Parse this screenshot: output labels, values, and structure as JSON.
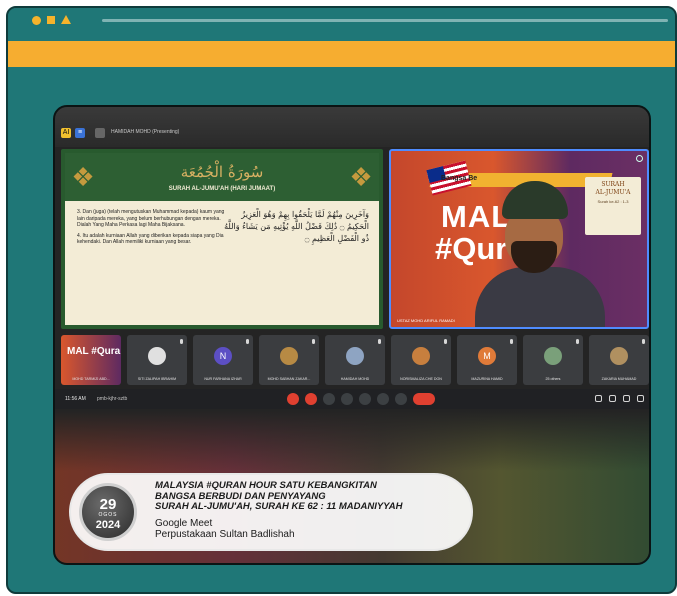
{
  "window": {
    "controls": [
      "circle",
      "square",
      "triangle"
    ],
    "accent": "#f6ad30",
    "frame_color": "#1f7777"
  },
  "meet": {
    "presenting_label": "HAMIDAH MOHD (Presenting)",
    "time": "11:56 AM",
    "code": "pmb-kjhr-sztb"
  },
  "slide": {
    "surah_arabic": "سُورَةُ الْجُمُعَة",
    "surah_title": "SURAH AL-JUMU'AH (HARI JUMAAT)",
    "verse3": "3. Dan (juga) (telah mengutuskan Muhammad kepada) kaum yang lain daripada mereka, yang belum berhubungan dengan mereka. Dialah Yang Maha Perkasa lagi Maha Bijaksana.",
    "verse4": "4. Itu adalah kurniaan Allah yang diberikan kepada siapa yang Dia kehendaki. Dan Allah memiliki kurniaan yang besar.",
    "arabic_text": "وَآخَرِينَ مِنْهُمْ لَمَّا يَلْحَقُوا بِهِمْ وَهُوَ الْعَزِيزُ الْحَكِيمُ ۝ ذَٰلِكَ فَضْلُ اللَّهِ يُؤْتِيهِ مَن يَشَاءُ وَاللَّهُ ذُو الْفَضْلِ الْعَظِيمِ ۝"
  },
  "speaker": {
    "banner_small": "Bangsa Be",
    "banner_big1": "MAL  A",
    "banner_big2": "#Qur   ur",
    "card_line1": "SURAH",
    "card_line2": "AL-JUMU'A",
    "card_line3": "Surah ke-62 : 1-3",
    "name": "USTAZ MOHD ARIFUL RAMADI"
  },
  "participants": [
    {
      "name": "MOHD TARMIZI ABD...",
      "self": true,
      "banner": "MAL #Qura"
    },
    {
      "name": "SITI ZALIPAH IBRAHIM",
      "initial": "",
      "color": "#e0e0e0"
    },
    {
      "name": "NUR FARHANA IZHAR",
      "initial": "N",
      "color": "#5c4fc4"
    },
    {
      "name": "MOHD SABHAN ZAKAR...",
      "initial": "",
      "color": "#b78a44"
    },
    {
      "name": "HAMIDAH MOHD",
      "initial": "",
      "color": "#8ea4c2"
    },
    {
      "name": "NORISMALIZA CHE DON",
      "initial": "",
      "color": "#c77f3e"
    },
    {
      "name": "MAZURINA HAMID",
      "initial": "M",
      "color": "#e07b39"
    },
    {
      "name": "25 others",
      "initial": "",
      "color": "#7aa07a"
    },
    {
      "name": "ZAKARIA MUHAMAD",
      "initial": "",
      "color": "#b09060"
    }
  ],
  "lower_third": {
    "headline1": "MALAYSIA #QURAN HOUR SATU KEBANGKITAN",
    "headline2": "BANGSA BERBUDI DAN PENYAYANG",
    "headline3": "SURAH AL-JUMU'AH, SURAH KE 62 : 11 MADANIYYAH",
    "platform": "Google Meet",
    "organizer": "Perpustakaan Sultan Badlishah",
    "date_day": "29",
    "date_month": "OGOS",
    "date_year": "2024"
  }
}
